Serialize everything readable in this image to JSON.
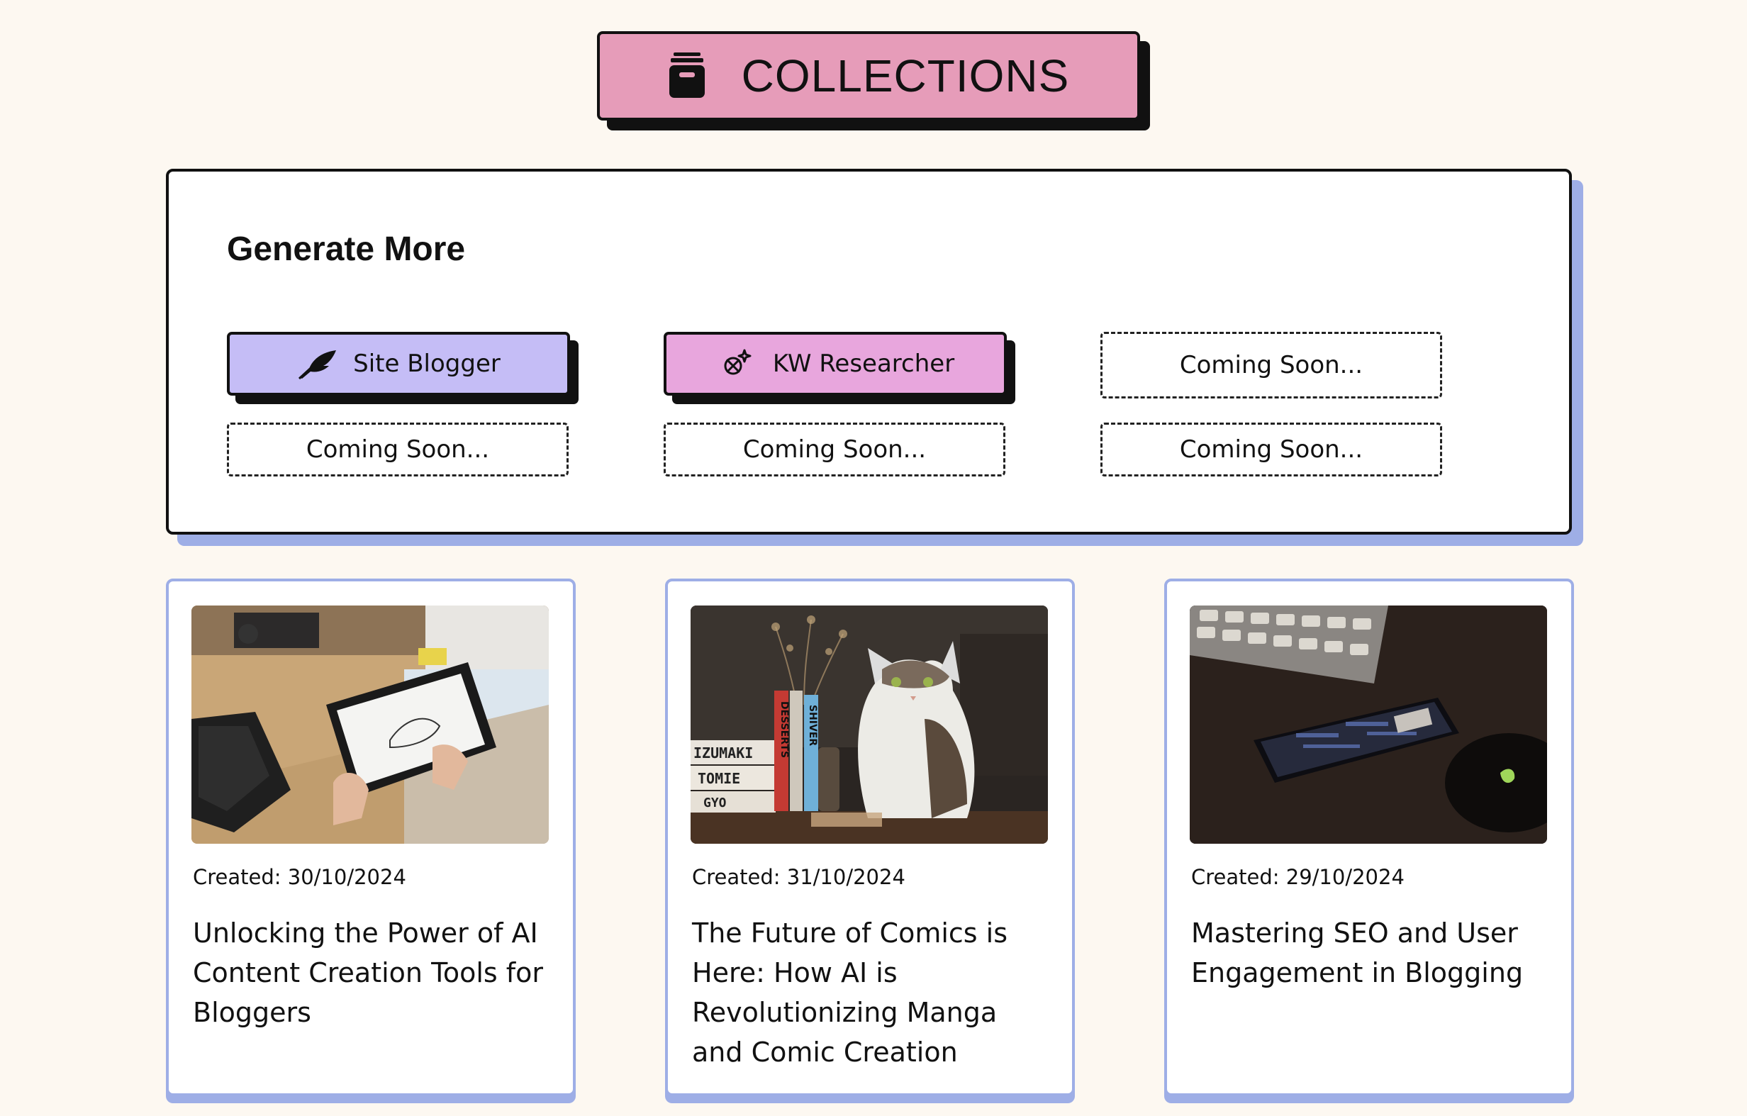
{
  "header": {
    "title": "COLLECTIONS",
    "icon": "archive-jar-icon",
    "color": "#e69cb9"
  },
  "generate": {
    "title": "Generate More",
    "tools": [
      {
        "label": "Site Blogger",
        "icon": "feather-icon",
        "color": "#c5bdf6"
      },
      {
        "label": "KW Researcher",
        "icon": "sparkle-search-icon",
        "color": "#e8a6dd"
      }
    ],
    "coming_soon": [
      "Coming Soon...",
      "Coming Soon...",
      "Coming Soon...",
      "Coming Soon..."
    ]
  },
  "collections": [
    {
      "date": "Created: 30/10/2024",
      "title": "Unlocking the Power of AI Content Creation Tools for Bloggers"
    },
    {
      "date": "Created: 31/10/2024",
      "title": "The Future of Comics is Here: How AI is Revolutionizing Manga and Comic Creation",
      "image_text": [
        "IZUMAKI",
        "TOMIE",
        "GYO",
        "DESSERTS",
        "SHIVER"
      ]
    },
    {
      "date": "Created: 29/10/2024",
      "title": "Mastering SEO and User Engagement in Blogging"
    }
  ]
}
